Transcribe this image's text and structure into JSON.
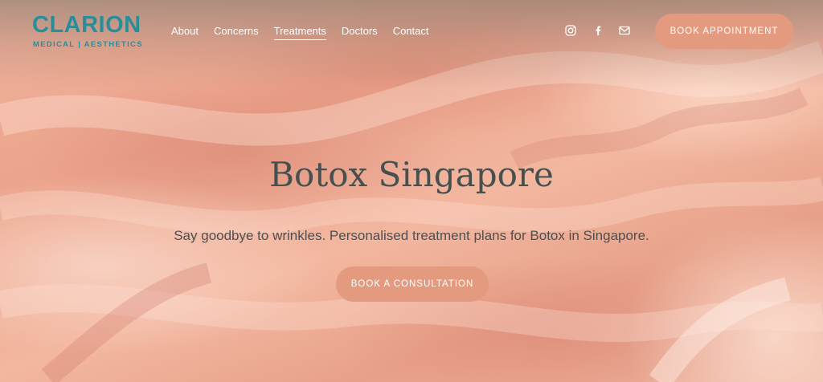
{
  "brand": {
    "name": "CLARION",
    "tagline": "MEDICAL | AESTHETICS",
    "color": "#2a8d9a"
  },
  "nav": {
    "items": [
      {
        "label": "About",
        "active": false
      },
      {
        "label": "Concerns",
        "active": false
      },
      {
        "label": "Treatments",
        "active": true
      },
      {
        "label": "Doctors",
        "active": false
      },
      {
        "label": "Contact",
        "active": false
      }
    ]
  },
  "social": {
    "icons": [
      "instagram-icon",
      "facebook-icon",
      "email-icon"
    ]
  },
  "header": {
    "book_label": "BOOK APPOINTMENT"
  },
  "hero": {
    "title": "Botox Singapore",
    "subtitle": "Say goodbye to wrinkles. Personalised treatment plans for Botox in Singapore.",
    "cta_label": "BOOK A CONSULTATION"
  },
  "colors": {
    "accent": "#e49a7f",
    "title": "#46504f",
    "background": "#f2b39d"
  }
}
